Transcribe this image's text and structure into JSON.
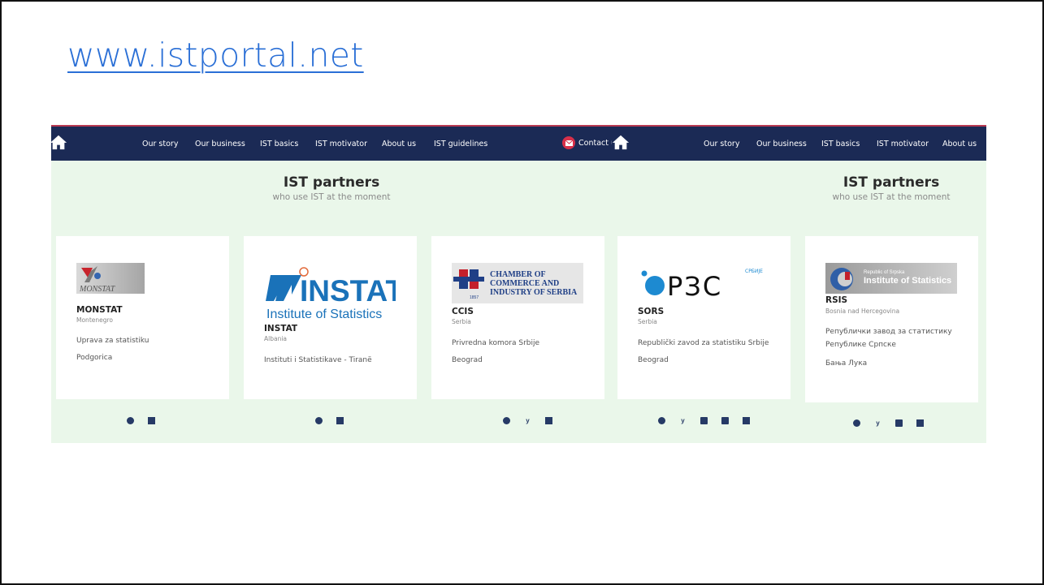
{
  "slide": {
    "title_link": "www.istportal.net"
  },
  "nav": {
    "items": [
      "Our story",
      "Our business",
      "IST basics",
      "IST motivator",
      "About us",
      "IST guidelines"
    ],
    "contact_label": "Contact us",
    "contact_label_clipped": "Contact u"
  },
  "section": {
    "title": "IST partners",
    "subtitle": "who use IST at the moment"
  },
  "partners": [
    {
      "code": "MONSTAT",
      "country": "Montenegro",
      "name": "Uprava za statistiku",
      "city": "Podgorica",
      "logo_text": "MONSTAT",
      "social": [
        "web",
        "email"
      ]
    },
    {
      "code": "INSTAT",
      "country": "Albania",
      "name": "Instituti i Statistikave - Tiranë",
      "city": "",
      "logo_text": "INSTAT",
      "logo_sub": "Institute of Statistics",
      "social": [
        "web",
        "email"
      ]
    },
    {
      "code": "CCIS",
      "country": "Serbia",
      "name": "Privredna komora Srbije",
      "city": "Beograd",
      "logo_text_1": "CHAMBER OF",
      "logo_text_2": "COMMERCE AND",
      "logo_text_3": "INDUSTRY OF SERBIA",
      "logo_year": "1857",
      "social": [
        "web",
        "twitter",
        "email"
      ]
    },
    {
      "code": "SORS",
      "country": "Serbia",
      "name": "Republički zavod za statistiku Srbije",
      "city": "Beograd",
      "logo_text": "РЗС",
      "logo_small": "СРБИЈЕ",
      "social": [
        "web",
        "twitter",
        "rss",
        "youtube",
        "email"
      ]
    },
    {
      "code": "RSIS",
      "country": "Bosnia nad Hercegovina",
      "name": "Републички завод за статистику",
      "name2": "Републике Српске",
      "city": "Бања Лука",
      "logo_small": "Republic of Srpska",
      "logo_text": "Institute of Statistics",
      "social": [
        "web",
        "twitter",
        "rss",
        "email"
      ]
    }
  ],
  "colors": {
    "navbar": "#1b2a55",
    "accent_line": "#b83a52",
    "section_bg": "#eaf7ea",
    "link": "#2a6fd6",
    "icon": "#263a66"
  }
}
